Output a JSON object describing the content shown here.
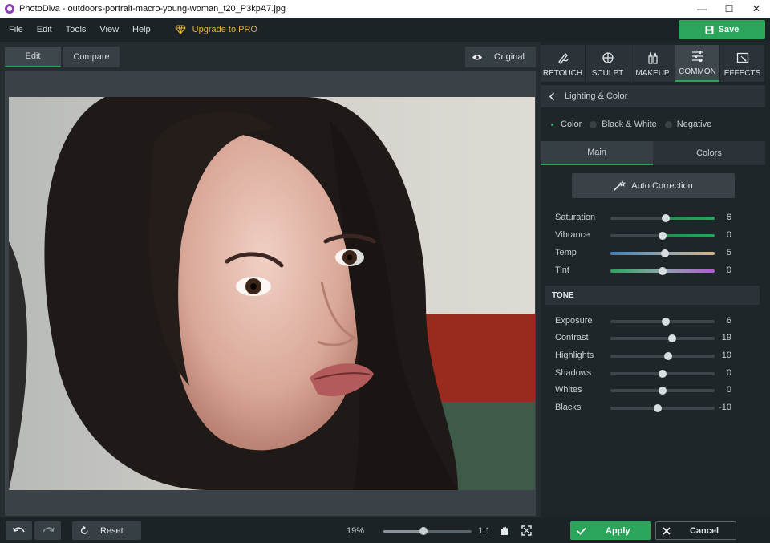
{
  "window": {
    "title": "PhotoDiva - outdoors-portrait-macro-young-woman_t20_P3kpA7.jpg",
    "minimize": "—",
    "maximize": "☐",
    "close": "✕"
  },
  "menu": {
    "items": [
      "File",
      "Edit",
      "Tools",
      "View",
      "Help"
    ],
    "upgrade_label": "Upgrade to PRO",
    "save_label": "Save"
  },
  "editor": {
    "tabs": [
      "Edit",
      "Compare"
    ],
    "active_tab": "Edit",
    "original_label": "Original"
  },
  "tools": {
    "tabs": [
      {
        "label": "RETOUCH",
        "icon": "retouch-icon"
      },
      {
        "label": "SCULPT",
        "icon": "sculpt-icon"
      },
      {
        "label": "MAKEUP",
        "icon": "makeup-icon"
      },
      {
        "label": "COMMON",
        "icon": "common-icon"
      },
      {
        "label": "EFFECTS",
        "icon": "effects-icon"
      }
    ],
    "active_tab": "COMMON"
  },
  "panel": {
    "section_title": "Lighting & Color",
    "modes": [
      "Color",
      "Black & White",
      "Negative"
    ],
    "selected_mode": "Color",
    "subtabs": [
      "Main",
      "Colors"
    ],
    "active_subtab": "Main",
    "auto_correction_label": "Auto Correction",
    "color_sliders": [
      {
        "label": "Saturation",
        "value": "6",
        "level": 6
      },
      {
        "label": "Vibrance",
        "value": "0",
        "level": 0
      },
      {
        "label": "Temp",
        "value": "5",
        "level": 5
      },
      {
        "label": "Tint",
        "value": "0",
        "level": 0
      }
    ],
    "tone_title": "TONE",
    "tone_sliders": [
      {
        "label": "Exposure",
        "value": "6",
        "level": 6
      },
      {
        "label": "Contrast",
        "value": "19",
        "level": 19
      },
      {
        "label": "Highlights",
        "value": "10",
        "level": 10
      },
      {
        "label": "Shadows",
        "value": "0",
        "level": 0
      },
      {
        "label": "Whites",
        "value": "0",
        "level": 0
      },
      {
        "label": "Blacks",
        "value": "-10",
        "level": -10
      }
    ],
    "slider_min": -100,
    "slider_max": 100
  },
  "bottom": {
    "reset_label": "Reset",
    "zoom_text": "19%",
    "zoom_level": 19,
    "one_to_one": "1:1",
    "apply_label": "Apply",
    "cancel_label": "Cancel"
  },
  "colors": {
    "accent": "#2aa55a",
    "upgrade": "#e2b23a"
  }
}
